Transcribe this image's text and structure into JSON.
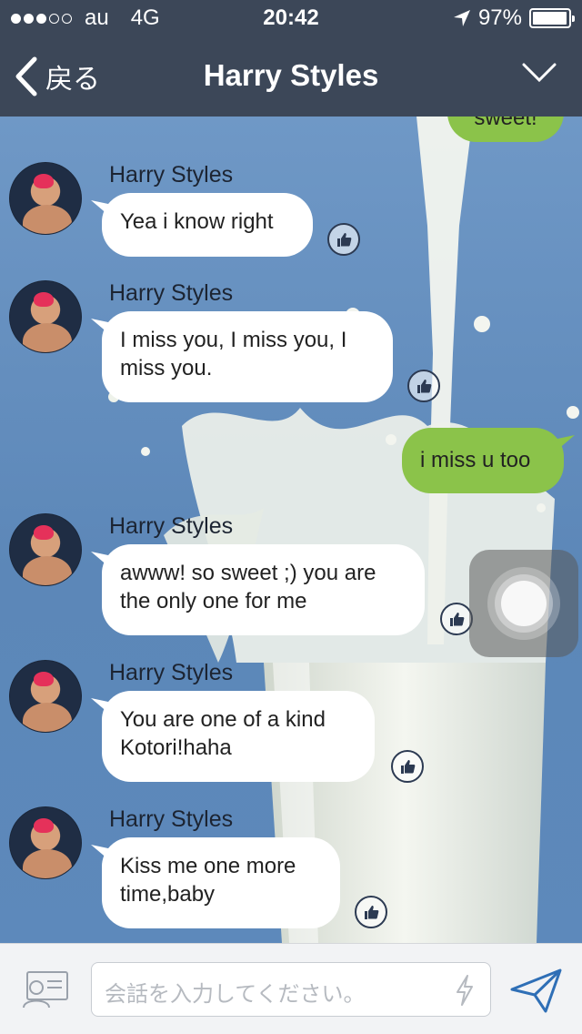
{
  "status_bar": {
    "carrier": "au",
    "network": "4G",
    "time": "20:42",
    "battery": "97%",
    "battery_level": 0.97
  },
  "header": {
    "back_label": "戻る",
    "title": "Harry Styles"
  },
  "partial_top_message": "sweet!",
  "messages": [
    {
      "sender": "Harry Styles",
      "text": "Yea i know right"
    },
    {
      "sender": "Harry Styles",
      "text": "I miss you, I miss you, I miss you."
    },
    {
      "text": "i miss u too"
    },
    {
      "sender": "Harry Styles",
      "text": "awww! so sweet ;) you are the only one for me"
    },
    {
      "sender": "Harry Styles",
      "text": "You are one of a kind Kotori!haha"
    },
    {
      "sender": "Harry Styles",
      "text": "Kiss me one more time,baby"
    }
  ],
  "input": {
    "placeholder": "会話を入力してください。"
  },
  "colors": {
    "header_bg": "#3c4758",
    "outgoing_bubble": "#8bc34a",
    "incoming_bubble": "#ffffff",
    "accent": "#2f6fb6"
  },
  "icons": [
    "back-chevron-icon",
    "dropdown-chevron-icon",
    "location-arrow-icon",
    "battery-icon",
    "like-icon",
    "contact-card-icon",
    "lightning-icon",
    "send-icon"
  ]
}
